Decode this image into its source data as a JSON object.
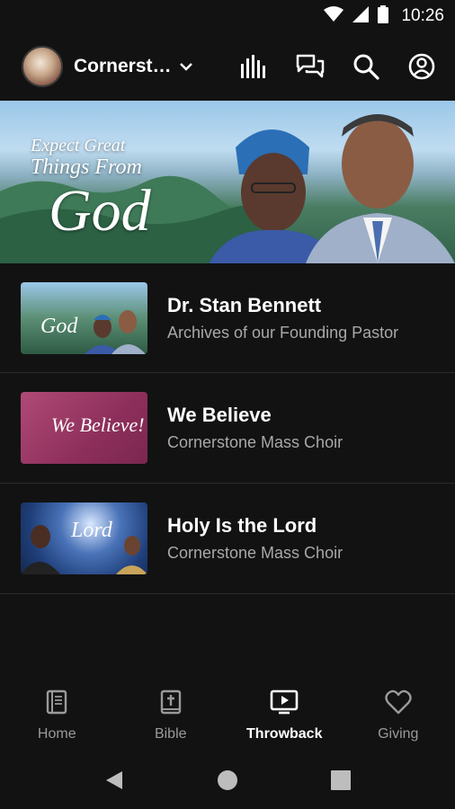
{
  "status": {
    "time": "10:26"
  },
  "header": {
    "church_name": "Cornerst…",
    "icons": [
      "equalizer-icon",
      "chat-icon",
      "search-icon",
      "account-icon"
    ]
  },
  "hero": {
    "line1": "Expect Great",
    "line2": "Things From",
    "line3": "God"
  },
  "items": [
    {
      "title": "Dr. Stan Bennett",
      "subtitle": "Archives of our Founding Pastor",
      "thumb_text": "God"
    },
    {
      "title": "We Believe",
      "subtitle": "Cornerstone Mass Choir",
      "thumb_text": "We Believe!"
    },
    {
      "title": "Holy Is the Lord",
      "subtitle": "Cornerstone Mass Choir",
      "thumb_text": "Lord"
    }
  ],
  "nav": [
    {
      "label": "Home",
      "icon": "book-icon"
    },
    {
      "label": "Bible",
      "icon": "bible-icon"
    },
    {
      "label": "Throwback",
      "icon": "tv-play-icon",
      "active": true
    },
    {
      "label": "Giving",
      "icon": "heart-icon"
    }
  ],
  "colors": {
    "background": "#121212",
    "active": "#ffffff",
    "inactive": "#9a9a9a",
    "subtitle": "#a8a8a8"
  }
}
